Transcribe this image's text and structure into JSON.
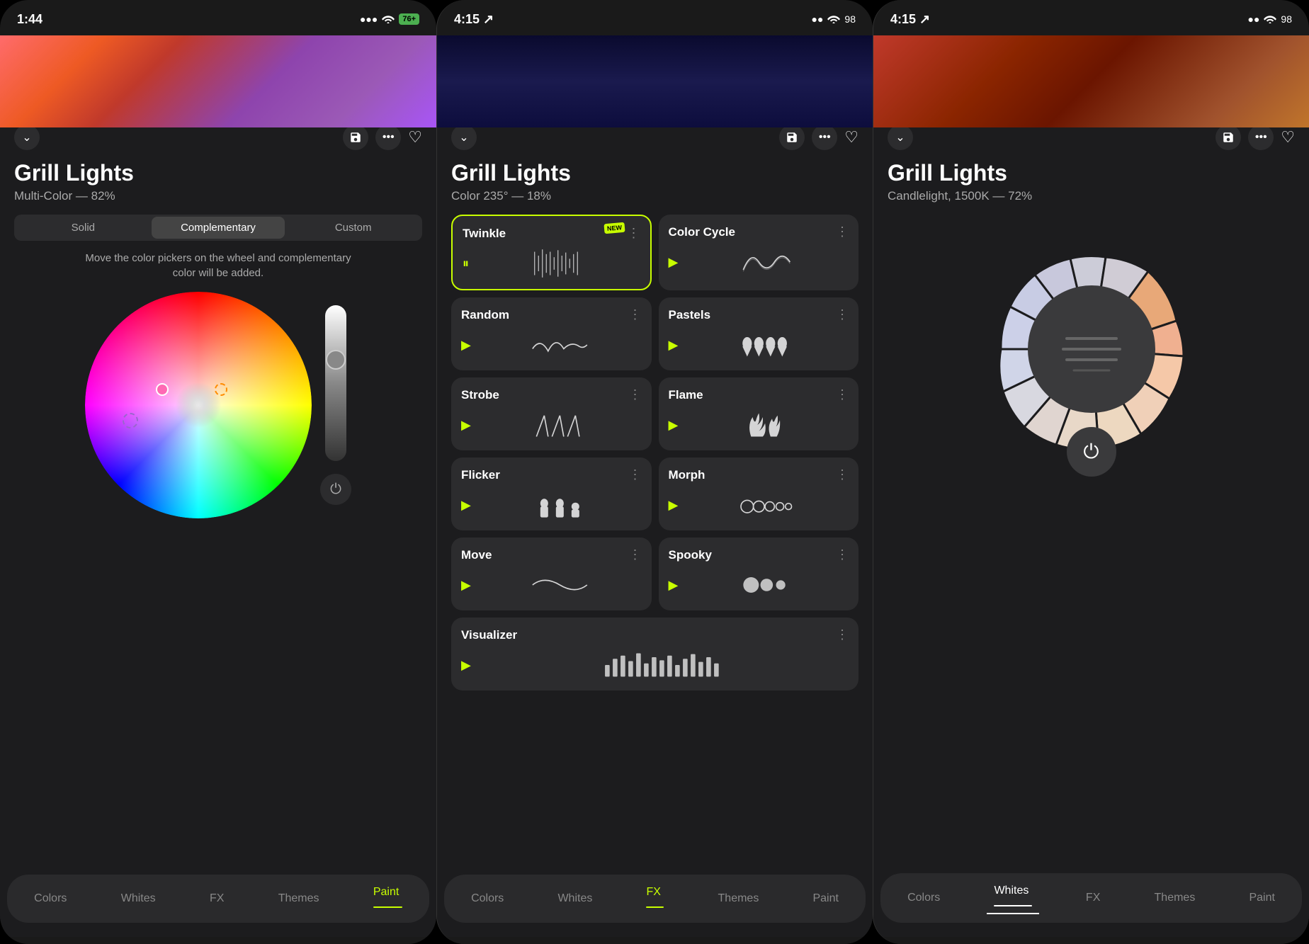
{
  "screens": [
    {
      "id": "screen1",
      "statusBar": {
        "time": "1:44",
        "hasLocation": true,
        "signal": "●●●",
        "wifi": "wifi",
        "battery": "76+"
      },
      "gradientClass": "screen1-gradient",
      "header": {
        "title": "Grill Lights",
        "subtitle": "Multi-Color — 82%"
      },
      "segControl": {
        "options": [
          "Solid",
          "Complementary",
          "Custom"
        ],
        "activeIndex": 1
      },
      "hintText": "Move the color pickers on the wheel and complementary color will be added.",
      "tabs": [
        {
          "label": "Colors",
          "active": false
        },
        {
          "label": "Whites",
          "active": false
        },
        {
          "label": "FX",
          "active": false
        },
        {
          "label": "Themes",
          "active": false
        },
        {
          "label": "Paint",
          "active": true
        }
      ],
      "activeTab": "Paint"
    },
    {
      "id": "screen2",
      "statusBar": {
        "time": "4:15",
        "hasLocation": true,
        "signal": "●●",
        "wifi": "wifi",
        "battery": "98"
      },
      "gradientClass": "screen2-gradient",
      "header": {
        "title": "Grill Lights",
        "subtitle": "Color 235° — 18%"
      },
      "fxItems": [
        {
          "name": "Twinkle",
          "selected": true,
          "isNew": true,
          "isPlaying": false,
          "isPaused": true
        },
        {
          "name": "Color Cycle",
          "selected": false,
          "isNew": false,
          "isPlaying": false
        },
        {
          "name": "Random",
          "selected": false,
          "isNew": false,
          "isPlaying": false
        },
        {
          "name": "Pastels",
          "selected": false,
          "isNew": false,
          "isPlaying": false
        },
        {
          "name": "Strobe",
          "selected": false,
          "isNew": false,
          "isPlaying": false
        },
        {
          "name": "Flame",
          "selected": false,
          "isNew": false,
          "isPlaying": false
        },
        {
          "name": "Flicker",
          "selected": false,
          "isNew": false,
          "isPlaying": false
        },
        {
          "name": "Morph",
          "selected": false,
          "isNew": false,
          "isPlaying": false
        },
        {
          "name": "Move",
          "selected": false,
          "isNew": false,
          "isPlaying": false
        },
        {
          "name": "Spooky",
          "selected": false,
          "isNew": false,
          "isPlaying": false
        },
        {
          "name": "Visualizer",
          "selected": false,
          "isNew": false,
          "isPlaying": false
        }
      ],
      "tabs": [
        {
          "label": "Colors",
          "active": false
        },
        {
          "label": "Whites",
          "active": false
        },
        {
          "label": "FX",
          "active": true
        },
        {
          "label": "Themes",
          "active": false
        },
        {
          "label": "Paint",
          "active": false
        }
      ],
      "activeTab": "FX"
    },
    {
      "id": "screen3",
      "statusBar": {
        "time": "4:15",
        "hasLocation": true,
        "signal": "●●",
        "wifi": "wifi",
        "battery": "98"
      },
      "gradientClass": "screen3-gradient",
      "header": {
        "title": "Grill Lights",
        "subtitle": "Candlelight, 1500K — 72%"
      },
      "tabs": [
        {
          "label": "Colors",
          "active": false
        },
        {
          "label": "Whites",
          "active": true
        },
        {
          "label": "FX",
          "active": false
        },
        {
          "label": "Themes",
          "active": false
        },
        {
          "label": "Paint",
          "active": false
        }
      ],
      "activeTab": "Whites"
    }
  ],
  "icons": {
    "chevronDown": "⌄",
    "save": "💾",
    "more": "•••",
    "heart": "♡",
    "heartFilled": "♥",
    "power": "⏻",
    "play": "▶",
    "pause": "⏸",
    "moreVert": "⋮",
    "location": "↗"
  }
}
